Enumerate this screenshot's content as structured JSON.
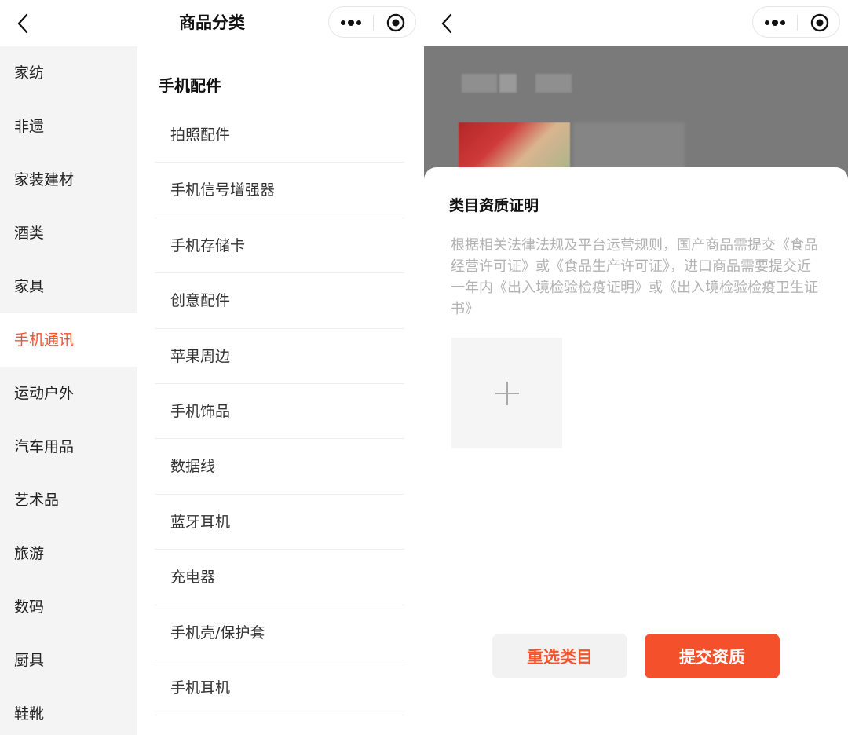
{
  "left": {
    "nav": {
      "title": "商品分类"
    },
    "sidebar": {
      "items": [
        {
          "label": "家纺"
        },
        {
          "label": "非遗"
        },
        {
          "label": "家装建材"
        },
        {
          "label": "酒类"
        },
        {
          "label": "家具"
        },
        {
          "label": "手机通讯"
        },
        {
          "label": "运动户外"
        },
        {
          "label": "汽车用品"
        },
        {
          "label": "艺术品"
        },
        {
          "label": "旅游"
        },
        {
          "label": "数码"
        },
        {
          "label": "厨具"
        },
        {
          "label": "鞋靴"
        }
      ],
      "active": "手机通讯"
    },
    "subcategory": {
      "header": "手机配件",
      "items": [
        {
          "label": "拍照配件"
        },
        {
          "label": "手机信号增强器"
        },
        {
          "label": "手机存储卡"
        },
        {
          "label": "创意配件"
        },
        {
          "label": "苹果周边"
        },
        {
          "label": "手机饰品"
        },
        {
          "label": "数据线"
        },
        {
          "label": "蓝牙耳机"
        },
        {
          "label": "充电器"
        },
        {
          "label": "手机壳/保护套"
        },
        {
          "label": "手机耳机"
        }
      ]
    }
  },
  "right": {
    "sheet": {
      "title": "类目资质证明",
      "description": "根据相关法律法规及平台运营规则，国产商品需提交《食品经营许可证》或《食品生产许可证》，进口商品需要提交近一年内《出入境检验检疫证明》或《出入境检验检疫卫生证书》",
      "upload_icon": "plus-icon"
    },
    "buttons": {
      "reselect": "重选类目",
      "submit": "提交资质"
    }
  },
  "colors": {
    "accent": "#f2542d",
    "submit_bg": "#f5502c",
    "sidebar_bg": "#f4f4f4",
    "overlay": "#7a7a7a",
    "muted_text": "#b3b3b3"
  }
}
